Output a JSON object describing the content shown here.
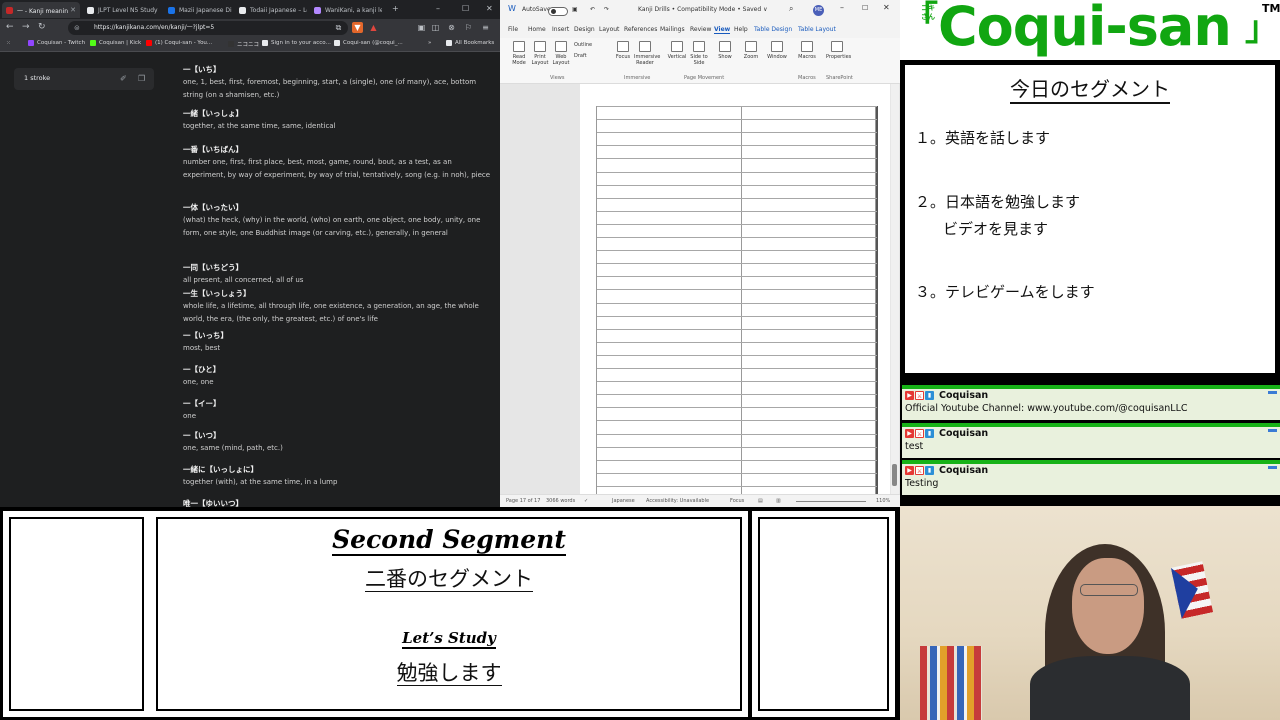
{
  "browser": {
    "tabs": [
      {
        "label": "一 - Kanji meanin",
        "color": "#c62828"
      },
      {
        "label": "JLPT Level N5 Study",
        "color": "#e8eaed"
      },
      {
        "label": "Mazii Japanese Dicti",
        "color": "#1a73e8"
      },
      {
        "label": "Todaii Japanese – Le",
        "color": "#e8eaed"
      },
      {
        "label": "WaniKani, a kanji lea",
        "color": "#b388ff"
      }
    ],
    "url": "https://kanjikana.com/en/kanji/一?jlpt=5",
    "bookmarks": [
      {
        "label": "Coquisan - Twitch",
        "color": "#9146ff"
      },
      {
        "label": "Coquisan | Kick",
        "color": "#53fc18"
      },
      {
        "label": "(1) Coqui-san - You...",
        "color": "#ff0000"
      },
      {
        "label": "ニコニコ",
        "color": "#333333"
      },
      {
        "label": "Sign in to your acco...",
        "color": "#e8eaed"
      },
      {
        "label": "Coqui-san (@coqui_...",
        "color": "#e8eaed"
      },
      {
        "label": "All Bookmarks",
        "color": "#e8eaed"
      }
    ],
    "stroke_label": "1 stroke",
    "entries": [
      {
        "word": "一【いち】",
        "def": "one, 1, best, first, foremost, beginning, start, a (single), one (of many), ace, bottom string (on a shamisen, etc.)"
      },
      {
        "word": "一緒【いっしょ】",
        "def": "together, at the same time, same, identical"
      },
      {
        "word": "一番【いちばん】",
        "def": "number one, first, first place, best, most, game, round, bout, as a test, as an experiment, by way of experiment, by way of trial, tentatively, song (e.g. in noh), piece"
      },
      {
        "word": "一体【いったい】",
        "def": "(what) the heck, (why) in the world, (who) on earth, one object, one body, unity, one form, one style, one Buddhist image (or carving, etc.), generally, in general"
      },
      {
        "word": "一同【いちどう】",
        "def": "all present, all concerned, all of us"
      },
      {
        "word": "一生【いっしょう】",
        "def": "whole life, a lifetime, all through life, one existence, a generation, an age, the whole world, the era, (the only, the greatest, etc.) of one's life"
      },
      {
        "word": "一【いっち】",
        "def": "most, best"
      },
      {
        "word": "一【ひと】",
        "def": "one, one"
      },
      {
        "word": "一【イー】",
        "def": "one"
      },
      {
        "word": "一【いつ】",
        "def": "one, same (mind, path, etc.)"
      },
      {
        "word": "一緒に【いっしょに】",
        "def": "together (with), at the same time, in a lump"
      },
      {
        "word": "唯一【ゆいいつ】",
        "def": ""
      }
    ]
  },
  "word": {
    "autosave": "AutoSave",
    "autosave_state": "Off",
    "doc_title": "Kanji Drills • Compatibility Mode • Saved ∨",
    "avatar": "ME",
    "tabs": [
      "File",
      "Home",
      "Insert",
      "Design",
      "Layout",
      "References",
      "Mailings",
      "Review",
      "View",
      "Help",
      "Table Design",
      "Table Layout"
    ],
    "ribbon_buttons": [
      {
        "label": "Read Mode"
      },
      {
        "label": "Print Layout"
      },
      {
        "label": "Web Layout"
      },
      {
        "label": "Focus"
      },
      {
        "label": "Immersive Reader"
      },
      {
        "label": "Vertical"
      },
      {
        "label": "Side to Side"
      },
      {
        "label": "Show"
      },
      {
        "label": "Zoom"
      },
      {
        "label": "Window"
      },
      {
        "label": "Macros"
      },
      {
        "label": "Properties"
      }
    ],
    "small_buttons": [
      "Outline",
      "Draft"
    ],
    "groups": [
      "Views",
      "Immersive",
      "Page Movement",
      "Macros",
      "SharePoint"
    ],
    "status": {
      "page": "Page 17 of 17",
      "words": "3066 words",
      "lang": "Japanese",
      "access": "Accessibility: Unavailable",
      "focus": "Focus",
      "zoom": "110%"
    }
  },
  "logo": {
    "small": "コキさん",
    "main": "Coqui-san",
    "bracket_l": "「",
    "bracket_r": "」",
    "tm": "TM",
    "color": "#11a611"
  },
  "today": {
    "title": "今日のセグメント",
    "items": [
      {
        "num": "１。",
        "text": "英語を話します"
      },
      {
        "num": "２。",
        "text": "日本語を勉強します"
      },
      {
        "num": "３。",
        "text": "テレビゲームをします"
      }
    ],
    "sub": "ビデオを見ます"
  },
  "chat": [
    {
      "user": "Coquisan",
      "text": "Official Youtube Channel: www.youtube.com/@coquisanLLC"
    },
    {
      "user": "Coquisan",
      "text": "test"
    },
    {
      "user": "Coquisan",
      "text": "Testing"
    }
  ],
  "segment": {
    "title": "Second Segment",
    "subtitle": "二番のセグメント",
    "study_en": "Let’s Study",
    "study_jp": "勉強します"
  }
}
